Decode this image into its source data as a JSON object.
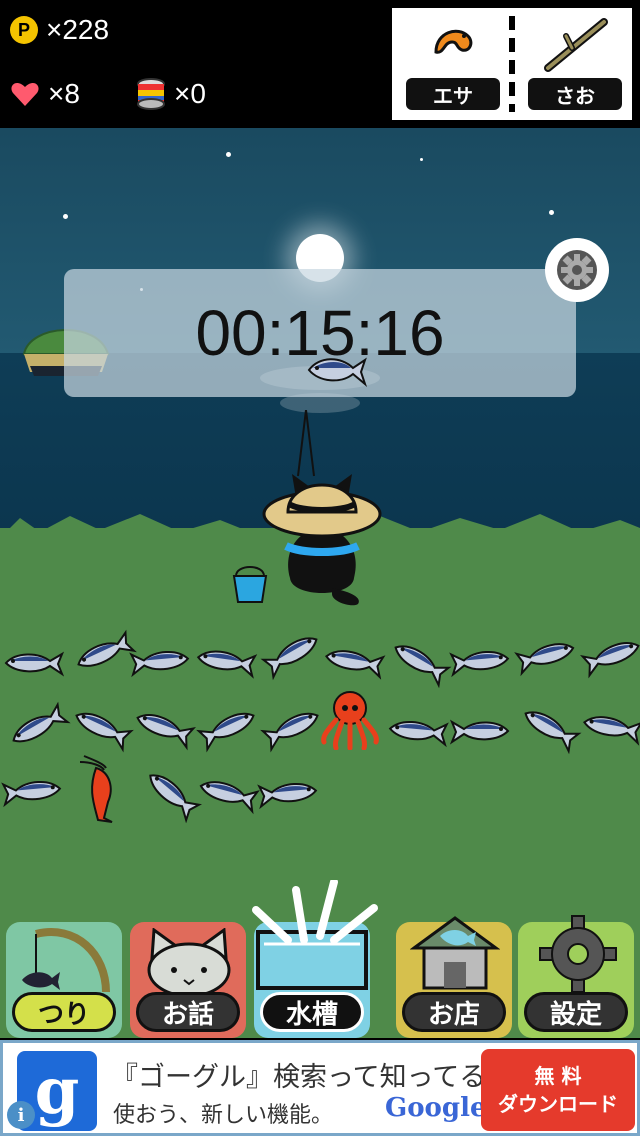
{
  "hud": {
    "coins": "×228",
    "coin_symbol": "P",
    "lives": "×8",
    "cans": "×0"
  },
  "equipment": {
    "bait_label": "エサ",
    "rod_label": "さお"
  },
  "timer": "00:15:16",
  "aquarium": {
    "fish_count": 26,
    "octopus_count": 1,
    "shrimp_count": 1
  },
  "nav": {
    "items": [
      {
        "label": "つり",
        "color": "#7fc7a4"
      },
      {
        "label": "お話",
        "color": "#e06b5b"
      },
      {
        "label": "水槽",
        "color": "#7fd1e4"
      },
      {
        "label": "お店",
        "color": "#d6c04d"
      },
      {
        "label": "設定",
        "color": "#9fcf5b"
      }
    ],
    "active": "水槽"
  },
  "ad": {
    "logo": "g",
    "line1": "『ゴーグル』検索って知ってる?",
    "line2": "使おう、新しい機能。",
    "brand": "Google",
    "cta_line1": "無 料",
    "cta_line2": "ダウンロード",
    "info": "i"
  },
  "colors": {
    "grass": "#4f8a4a",
    "sea": "#0e3d56",
    "ad_cta": "#e53a2c"
  }
}
